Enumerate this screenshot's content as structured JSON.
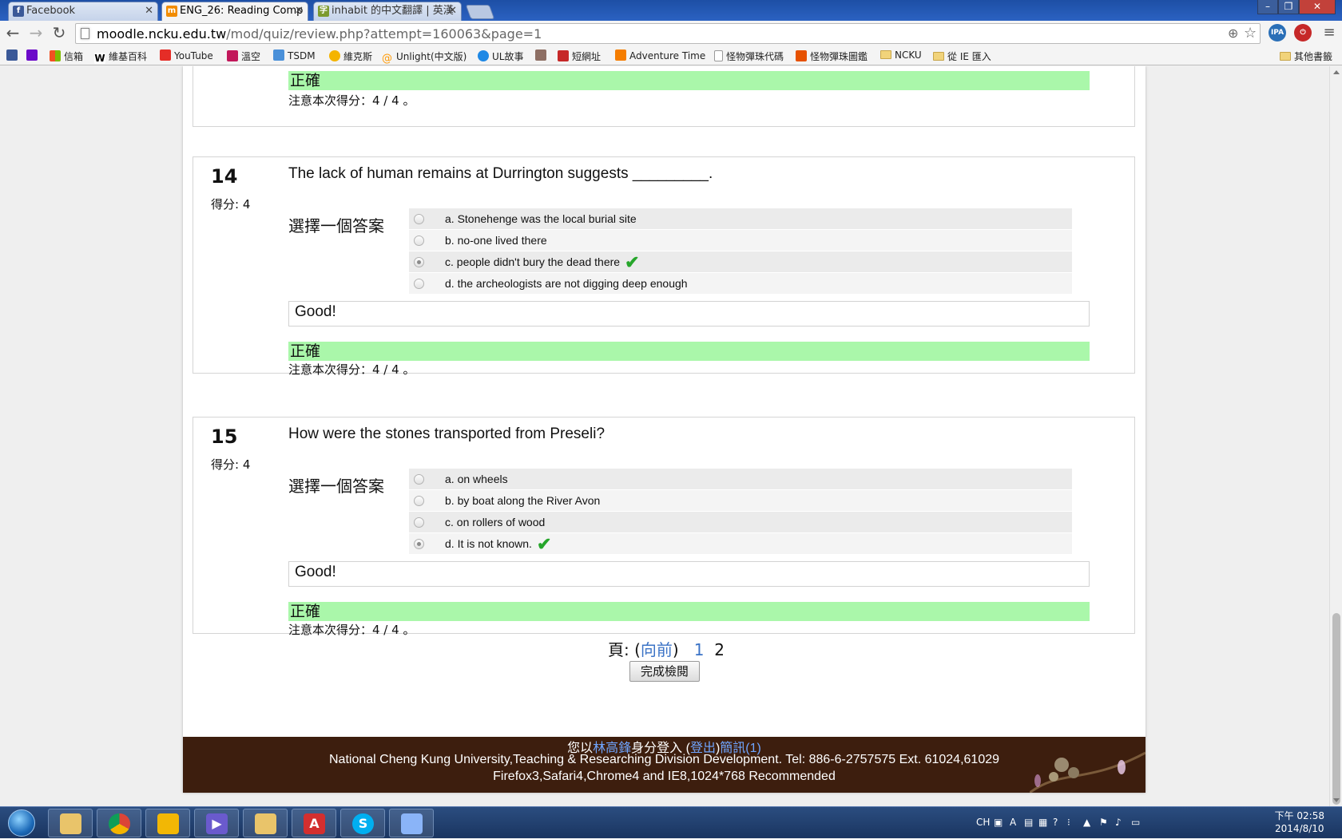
{
  "browser": {
    "tabs": [
      {
        "title": "Facebook",
        "icon": "facebook-icon",
        "color": "#3b5998"
      },
      {
        "title": "ENG_26: Reading Comp",
        "icon": "moodle-icon",
        "color": "#f28c00"
      },
      {
        "title": "inhabit 的中文翻譯 | 英漢",
        "icon": "dictionary-icon",
        "color": "#7c9a2e"
      }
    ],
    "url_host": "moodle.ncku.edu.tw",
    "url_path": "/mod/quiz/review.php?attempt=160063&page=1",
    "bookmarks": [
      {
        "label": "",
        "icon": "facebook-icon",
        "color": "#3b5998"
      },
      {
        "label": "",
        "icon": "yahoo-icon",
        "color": "#6b0ac9"
      },
      {
        "label": "信箱",
        "icon": "windows-icon",
        "color": "#e8a13a"
      },
      {
        "label": "維基百科",
        "icon": "wikipedia-icon",
        "color": "#ffffff"
      },
      {
        "label": "YouTube",
        "icon": "youtube-icon",
        "color": "#e52d27"
      },
      {
        "label": "溫空",
        "icon": "site-icon",
        "color": "#c2185b"
      },
      {
        "label": "TSDM",
        "icon": "site-icon",
        "color": "#4a90d9"
      },
      {
        "label": "維克斯",
        "icon": "site-icon",
        "color": "#f4b400"
      },
      {
        "label": "Unlight(中文版)",
        "icon": "at-icon",
        "color": "#ff9800"
      },
      {
        "label": "UL故事",
        "icon": "site-icon",
        "color": "#1e88e5"
      },
      {
        "label": "",
        "icon": "site-icon",
        "color": "#8d6e63"
      },
      {
        "label": "短網址",
        "icon": "site-icon",
        "color": "#c62828"
      },
      {
        "label": "Adventure Time",
        "icon": "blogger-icon",
        "color": "#f57d00"
      },
      {
        "label": "怪物彈珠代碼",
        "icon": "page-icon",
        "color": "#ffffff"
      },
      {
        "label": "怪物彈珠圖鑑",
        "icon": "site-icon",
        "color": "#e65100"
      },
      {
        "label": "NCKU",
        "icon": "folder-icon",
        "color": "#f1d37a"
      },
      {
        "label": "從 IE 匯入",
        "icon": "folder-icon",
        "color": "#f1d37a"
      }
    ],
    "other_bookmarks": "其他書籤",
    "extensions": [
      {
        "label": "IPA",
        "color": "#2a6fb7"
      },
      {
        "label": "",
        "color": "#c62828"
      }
    ]
  },
  "quiz": {
    "prev_block": {
      "status": "正確",
      "mark_note": "注意本次得分：4 / 4 。"
    },
    "questions": [
      {
        "number": "14",
        "mark": "得分: 4",
        "text": "The lack of human remains at Durrington suggests _________.",
        "prompt": "選擇一個答案",
        "answers": [
          {
            "label": "a. Stonehenge was the local burial site",
            "selected": false,
            "correct": false
          },
          {
            "label": "b. no-one lived there",
            "selected": false,
            "correct": false
          },
          {
            "label": "c. people didn't bury the dead there",
            "selected": true,
            "correct": true
          },
          {
            "label": "d. the archeologists are not digging deep enough",
            "selected": false,
            "correct": false
          }
        ],
        "feedback": "Good!",
        "status": "正確",
        "mark_note": "注意本次得分：4 / 4 。"
      },
      {
        "number": "15",
        "mark": "得分: 4",
        "text": "How were the stones transported from Preseli?",
        "prompt": "選擇一個答案",
        "answers": [
          {
            "label": "a. on wheels",
            "selected": false,
            "correct": false
          },
          {
            "label": "b. by boat along the River Avon",
            "selected": false,
            "correct": false
          },
          {
            "label": "c. on rollers of wood",
            "selected": false,
            "correct": false
          },
          {
            "label": "d. It is not known.",
            "selected": true,
            "correct": true
          }
        ],
        "feedback": "Good!",
        "status": "正確",
        "mark_note": "注意本次得分：4 / 4 。"
      }
    ],
    "pager": {
      "label": "頁: (",
      "prev": "向前",
      "close": ")",
      "page1": "1",
      "page2": "2"
    },
    "finish_button": "完成檢閱"
  },
  "footer": {
    "login_prefix": "您以",
    "user": "林高鋒",
    "login_mid": "身分登入 (",
    "logout": "登出",
    "login_close": ")",
    "messages": "簡訊(1)",
    "line2": "National Cheng Kung University,Teaching & Researching Division Development. Tel: 886-6-2757575 Ext. 61024,61029",
    "line3": "Firefox3,Safari4,Chrome4 and IE8,1024*768 Recommended"
  },
  "taskbar": {
    "apps": [
      {
        "name": "explorer-icon",
        "color": "#e9c46a"
      },
      {
        "name": "chrome-icon",
        "color": "#4285f4"
      },
      {
        "name": "app-icon",
        "color": "#f2b705"
      },
      {
        "name": "media-icon",
        "color": "#6a5acd"
      },
      {
        "name": "folder-icon",
        "color": "#e9c46a"
      },
      {
        "name": "pdf-icon",
        "color": "#d32f2f"
      },
      {
        "name": "skype-icon",
        "color": "#00aff0"
      },
      {
        "name": "paint-icon",
        "color": "#8ab4f8"
      }
    ],
    "ime": "CH",
    "time_period": "下午 02:58",
    "date": "2014/8/10"
  }
}
